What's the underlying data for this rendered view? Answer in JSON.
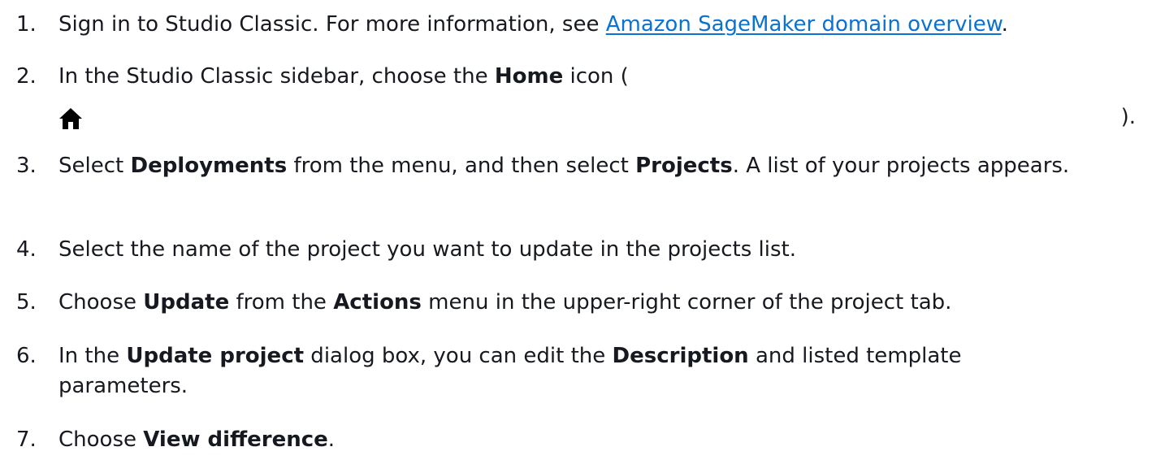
{
  "steps": [
    {
      "number": "1.",
      "pre": "Sign in to Studio Classic. For more information, see ",
      "link": "Amazon SageMaker domain overview",
      "post": "."
    },
    {
      "number": "2.",
      "pre": "In the Studio Classic sidebar, choose the ",
      "b1": "Home",
      "post": " icon (",
      "icon": "home-icon",
      "close": ")."
    },
    {
      "number": "3.",
      "pre": "Select ",
      "b1": "Deployments",
      "mid": " from the menu, and then select ",
      "b2": "Projects",
      "post": ". A list of your projects appears."
    },
    {
      "number": "4.",
      "text": "Select the name of the project you want to update in the projects list."
    },
    {
      "number": "5.",
      "pre": "Choose ",
      "b1": "Update",
      "mid": " from the ",
      "b2": "Actions",
      "post": " menu in the upper-right corner of the project tab."
    },
    {
      "number": "6.",
      "pre": "In the ",
      "b1": "Update project",
      "mid": " dialog box, you can edit the ",
      "b2": "Description",
      "post": " and listed template parameters."
    },
    {
      "number": "7.",
      "pre": "Choose ",
      "b1": "View difference",
      "post": "."
    }
  ]
}
